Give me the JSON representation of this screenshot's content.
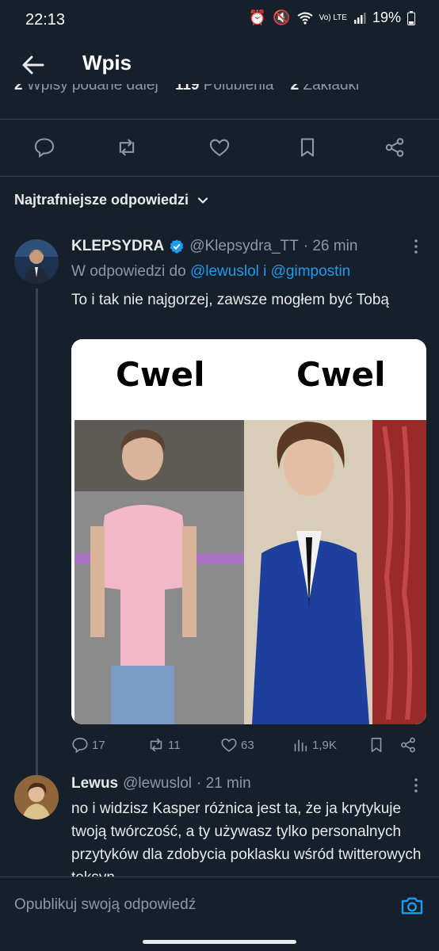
{
  "status_bar": {
    "time": "22:13",
    "battery": "19%",
    "network": "Vo) LTE"
  },
  "header": {
    "title": "Wpis"
  },
  "stats": {
    "reposts_count": "2",
    "reposts_label": "Wpisy podane dalej",
    "likes_count": "119",
    "likes_label": "Polubienia",
    "bookmarks_count": "2",
    "bookmarks_label": "Zakładki"
  },
  "sort": {
    "label": "Najtrafniejsze odpowiedzi"
  },
  "reply1": {
    "name": "KLEPSYDRA",
    "handle": "@Klepsydra_TT",
    "time": "· 26 min",
    "in_reply_prefix": "W odpowiedzi do",
    "in_reply_users": "@lewuslol i @gimpostin",
    "text": "To i tak nie najgorzej, zawsze mogłem być Tobą",
    "media": {
      "left_label": "Cwel",
      "right_label": "Cwel"
    },
    "replies": "17",
    "reposts": "11",
    "likes": "63",
    "views": "1,9K"
  },
  "reply2": {
    "name": "Lewus",
    "handle": "@lewuslol",
    "time": "· 21 min",
    "text": "no i widzisz Kasper różnica jest ta, że ja krytykuje twoją twórczość, a ty używasz tylko personalnych przytyków dla zdobycia poklasku wśród twitterowych toksyn"
  },
  "composer": {
    "placeholder": "Opublikuj swoją odpowiedź"
  },
  "colors": {
    "background": "#15202b",
    "accent": "#1d9bf0",
    "muted": "#8b98a5",
    "divider": "#38444d"
  }
}
